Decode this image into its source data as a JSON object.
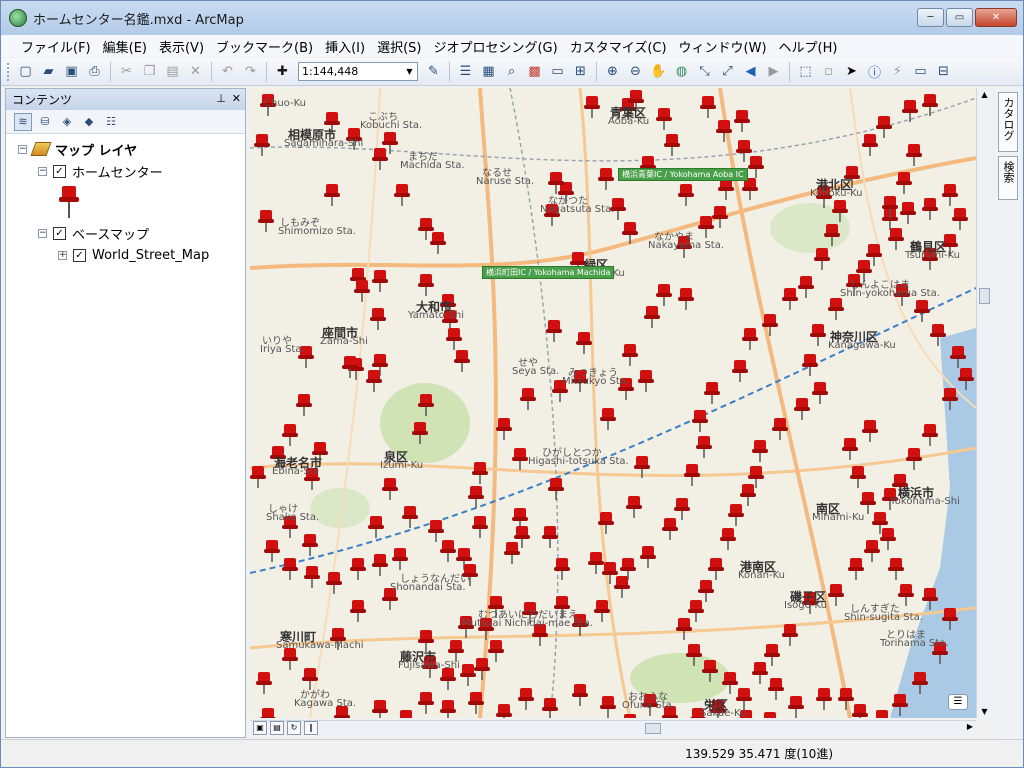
{
  "window": {
    "title": "ホームセンター名鑑.mxd - ArcMap",
    "minimize": "─",
    "maximize": "▭",
    "close": "✕"
  },
  "menu": [
    "ファイル(F)",
    "編集(E)",
    "表示(V)",
    "ブックマーク(B)",
    "挿入(I)",
    "選択(S)",
    "ジオプロセシング(G)",
    "カスタマイズ(C)",
    "ウィンドウ(W)",
    "ヘルプ(H)"
  ],
  "toolbar": {
    "scale": "1:144,448"
  },
  "toc": {
    "title": "コンテンツ",
    "pin": "⊥",
    "close": "✕",
    "root": "マップ レイヤ",
    "layer1": "ホームセンター",
    "layer2": "ベースマップ",
    "sublayer": "World_Street_Map"
  },
  "right_dock": {
    "catalog": "カタログ",
    "search": "検索"
  },
  "map": {
    "labels": [
      {
        "t": "Chuo-Ku",
        "big": false
      },
      {
        "t": "相模原市",
        "big": true
      },
      {
        "t": "Sagamihara-Shi",
        "big": false
      },
      {
        "t": "こぶち",
        "big": false
      },
      {
        "t": "Kobuchi Sta.",
        "big": false
      },
      {
        "t": "青葉区",
        "big": true
      },
      {
        "t": "Aoba-Ku",
        "big": false
      },
      {
        "t": "まちだ",
        "big": false
      },
      {
        "t": "Machida Sta.",
        "big": false
      },
      {
        "t": "なるせ",
        "big": false
      },
      {
        "t": "Naruse Sta.",
        "big": false
      },
      {
        "t": "ながつた",
        "big": false
      },
      {
        "t": "Nagatsuta Sta.",
        "big": false
      },
      {
        "t": "しもみぞ",
        "big": false
      },
      {
        "t": "Shimomizo Sta.",
        "big": false
      },
      {
        "t": "緑区",
        "big": true
      },
      {
        "t": "Midori-Ku",
        "big": false
      },
      {
        "t": "なかやま",
        "big": false
      },
      {
        "t": "Nakayama Sta.",
        "big": false
      },
      {
        "t": "港北区",
        "big": true
      },
      {
        "t": "Kohoku-Ku",
        "big": false
      },
      {
        "t": "鶴見区",
        "big": true
      },
      {
        "t": "Tsurumi-Ku",
        "big": false
      },
      {
        "t": "しんよこはま",
        "big": false
      },
      {
        "t": "Shin-yokohama Sta.",
        "big": false
      },
      {
        "t": "神奈川区",
        "big": true
      },
      {
        "t": "Kanagawa-Ku",
        "big": false
      },
      {
        "t": "大和市",
        "big": true
      },
      {
        "t": "Yamato-Shi",
        "big": false
      },
      {
        "t": "座間市",
        "big": true
      },
      {
        "t": "Zama-Shi",
        "big": false
      },
      {
        "t": "いりや",
        "big": false
      },
      {
        "t": "Iriya Sta.",
        "big": false
      },
      {
        "t": "せや",
        "big": false
      },
      {
        "t": "Seya Sta.",
        "big": false
      },
      {
        "t": "みつきょう",
        "big": false
      },
      {
        "t": "Mitsukyo Sta.",
        "big": false
      },
      {
        "t": "海老名市",
        "big": true
      },
      {
        "t": "Ebina-Shi",
        "big": false
      },
      {
        "t": "泉区",
        "big": true
      },
      {
        "t": "Izumi-Ku",
        "big": false
      },
      {
        "t": "ひがしとつか",
        "big": false
      },
      {
        "t": "Higashi-totsuka Sta.",
        "big": false
      },
      {
        "t": "南区",
        "big": true
      },
      {
        "t": "Minami-Ku",
        "big": false
      },
      {
        "t": "横浜市",
        "big": true
      },
      {
        "t": "Yokohama-Shi",
        "big": false
      },
      {
        "t": "しゃけ",
        "big": false
      },
      {
        "t": "Shake Sta.",
        "big": false
      },
      {
        "t": "港南区",
        "big": true
      },
      {
        "t": "Konan-Ku",
        "big": false
      },
      {
        "t": "磯子区",
        "big": true
      },
      {
        "t": "Isogo-Ku",
        "big": false
      },
      {
        "t": "しんすぎた",
        "big": false
      },
      {
        "t": "Shin-sugita Sta.",
        "big": false
      },
      {
        "t": "しょうなんだい",
        "big": false
      },
      {
        "t": "Shonandai Sta.",
        "big": false
      },
      {
        "t": "むつあいにちだいまえ",
        "big": false
      },
      {
        "t": "Mutsuai Nichidai-mae Sta.",
        "big": false
      },
      {
        "t": "寒川町",
        "big": true
      },
      {
        "t": "Samukawa-Machi",
        "big": false
      },
      {
        "t": "藤沢市",
        "big": true
      },
      {
        "t": "Fujisawa-Shi",
        "big": false
      },
      {
        "t": "とりはま",
        "big": false
      },
      {
        "t": "Torihama Sta.",
        "big": false
      },
      {
        "t": "栄区",
        "big": true
      },
      {
        "t": "Sakae-Ku",
        "big": false
      },
      {
        "t": "かがわ",
        "big": false
      },
      {
        "t": "Kagawa Sta.",
        "big": false
      },
      {
        "t": "おおふな",
        "big": false
      },
      {
        "t": "Ofuna Sta.",
        "big": false
      }
    ],
    "badges": [
      {
        "t": "横浜青葉IC / Yokohama Aoba IC"
      },
      {
        "t": "横浜町田IC / Yokohama Machida"
      }
    ]
  },
  "status": {
    "coords": "139.529  35.471 度(10進)"
  },
  "colors": {
    "pin": "#d10f0f",
    "water": "#a9c9e4",
    "park": "#cfe3b4",
    "road_major": "#f4b97e",
    "rail_dash": "#3b7fc9"
  }
}
